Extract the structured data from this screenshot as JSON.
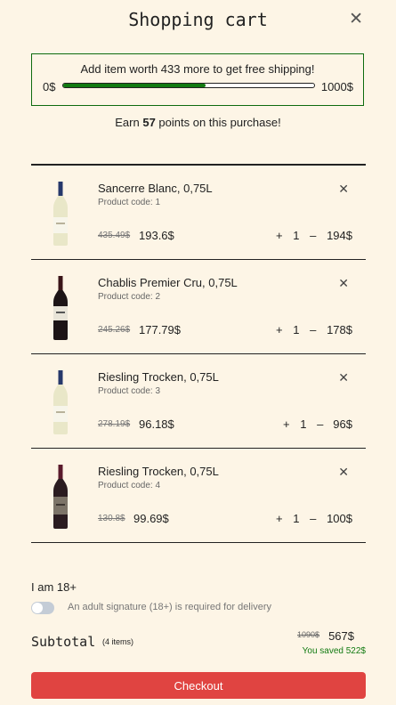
{
  "header": {
    "title": "Shopping cart",
    "close_label": "✕"
  },
  "shipping": {
    "message": "Add item worth 433 more to get free shipping!",
    "min_label": "0$",
    "max_label": "1000$",
    "progress_fraction": 0.567
  },
  "points": {
    "prefix": "Earn ",
    "value": "57",
    "suffix": " points on this purchase!"
  },
  "items": [
    {
      "name": "Sancerre Blanc, 0,75L",
      "code": "Product code: 1",
      "old_price": "435.49$",
      "price": "193.6$",
      "plus": "+",
      "qty": "1",
      "minus": "–",
      "total": "194$",
      "remove": "✕",
      "wine": "white"
    },
    {
      "name": "Chablis Premier Cru, 0,75L",
      "code": "Product code: 2",
      "old_price": "245.26$",
      "price": "177.79$",
      "plus": "+",
      "qty": "1",
      "minus": "–",
      "total": "178$",
      "remove": "✕",
      "wine": "red"
    },
    {
      "name": "Riesling Trocken, 0,75L",
      "code": "Product code: 3",
      "old_price": "278.19$",
      "price": "96.18$",
      "plus": "+",
      "qty": "1",
      "minus": "–",
      "total": "96$",
      "remove": "✕",
      "wine": "white"
    },
    {
      "name": "Riesling Trocken, 0,75L",
      "code": "Product code: 4",
      "old_price": "130.8$",
      "price": "99.69$",
      "plus": "+",
      "qty": "1",
      "minus": "–",
      "total": "100$",
      "remove": "✕",
      "wine": "red"
    }
  ],
  "age": {
    "label": "I am 18+",
    "toggle_on": false,
    "note": "An adult signature (18+) is required for delivery"
  },
  "subtotal": {
    "label": "Subtotal",
    "count": "(4 items)",
    "old": "1090$",
    "total": "567$",
    "saved": "You saved 522$"
  },
  "checkout": {
    "label": "Checkout"
  },
  "colors": {
    "accent_green": "#117a11",
    "checkout_red": "#e04441",
    "background": "#fdf5e6"
  }
}
